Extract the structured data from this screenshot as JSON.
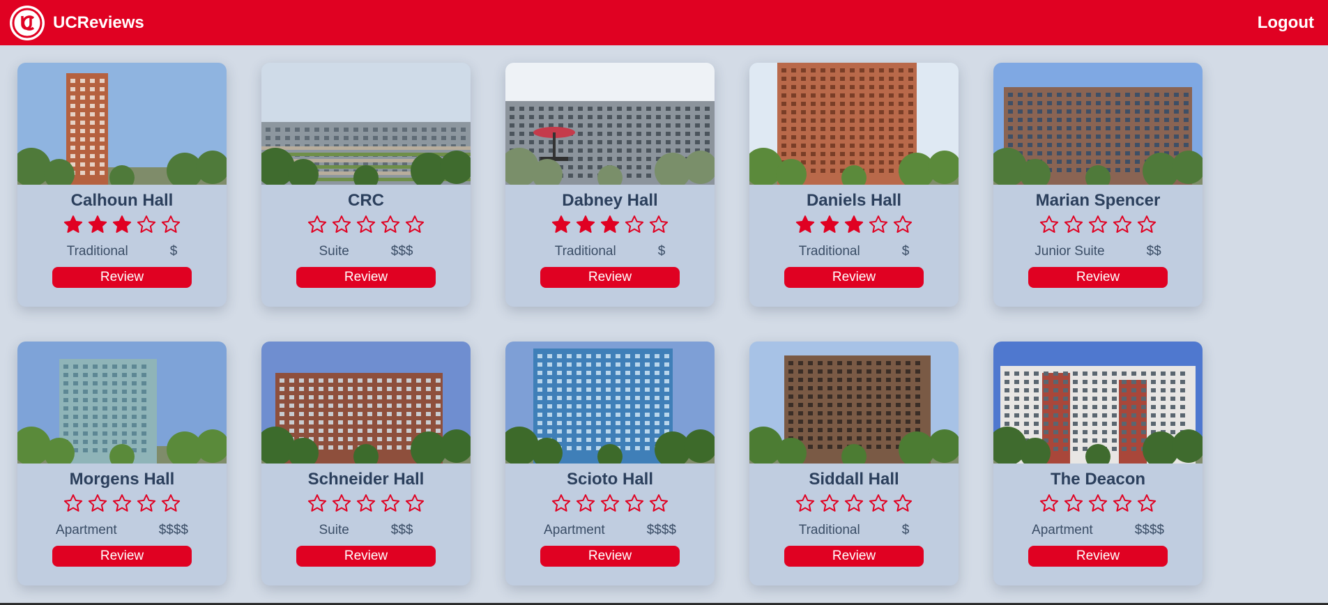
{
  "app": {
    "brand": "UCReviews",
    "logout_label": "Logout",
    "accent_color": "#e00122",
    "page_background": "#d3dbe6",
    "card_background": "#c0cde0"
  },
  "review_label": "Review",
  "halls": [
    {
      "name": "Calhoun Hall",
      "rating": 3,
      "type": "Traditional",
      "price": "$"
    },
    {
      "name": "CRC",
      "rating": 0,
      "type": "Suite",
      "price": "$$$"
    },
    {
      "name": "Dabney Hall",
      "rating": 3,
      "type": "Traditional",
      "price": "$"
    },
    {
      "name": "Daniels Hall",
      "rating": 3,
      "type": "Traditional",
      "price": "$"
    },
    {
      "name": "Marian Spencer",
      "rating": 0,
      "type": "Junior Suite",
      "price": "$$"
    },
    {
      "name": "Morgens Hall",
      "rating": 0,
      "type": "Apartment",
      "price": "$$$$"
    },
    {
      "name": "Schneider Hall",
      "rating": 0,
      "type": "Suite",
      "price": "$$$"
    },
    {
      "name": "Scioto Hall",
      "rating": 0,
      "type": "Apartment",
      "price": "$$$$"
    },
    {
      "name": "Siddall Hall",
      "rating": 0,
      "type": "Traditional",
      "price": "$"
    },
    {
      "name": "The Deacon",
      "rating": 0,
      "type": "Apartment",
      "price": "$$$$"
    }
  ]
}
